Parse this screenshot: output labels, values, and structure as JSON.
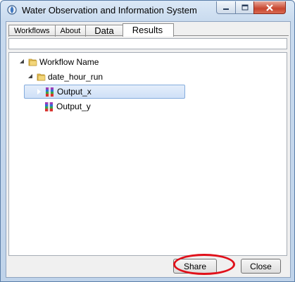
{
  "window": {
    "title": "Water Observation and Information System",
    "icons": {
      "app": "app-logo-icon",
      "minimize": "minimize-icon",
      "maximize": "maximize-icon",
      "close": "close-icon"
    }
  },
  "tabs": [
    {
      "label": "Workflows",
      "active": false
    },
    {
      "label": "About",
      "active": false
    },
    {
      "label": "Data",
      "active": false
    },
    {
      "label": "Results",
      "active": true
    }
  ],
  "path_field": {
    "value": ""
  },
  "tree": {
    "root": {
      "label": "Workflow Name",
      "icon": "folder-icon",
      "expanded": true
    },
    "child": {
      "label": "date_hour_run",
      "icon": "folder-icon",
      "expanded": true
    },
    "items": [
      {
        "label": "Output_x",
        "icon": "archive-icon",
        "selected": true
      },
      {
        "label": "Output_y",
        "icon": "archive-icon",
        "selected": false
      }
    ]
  },
  "buttons": {
    "share_label": "Share",
    "close_label": "Close"
  },
  "colors": {
    "highlight_ring": "#e0101a",
    "selection": "#cfe0f7",
    "title_bar": "#dbe8f6"
  }
}
